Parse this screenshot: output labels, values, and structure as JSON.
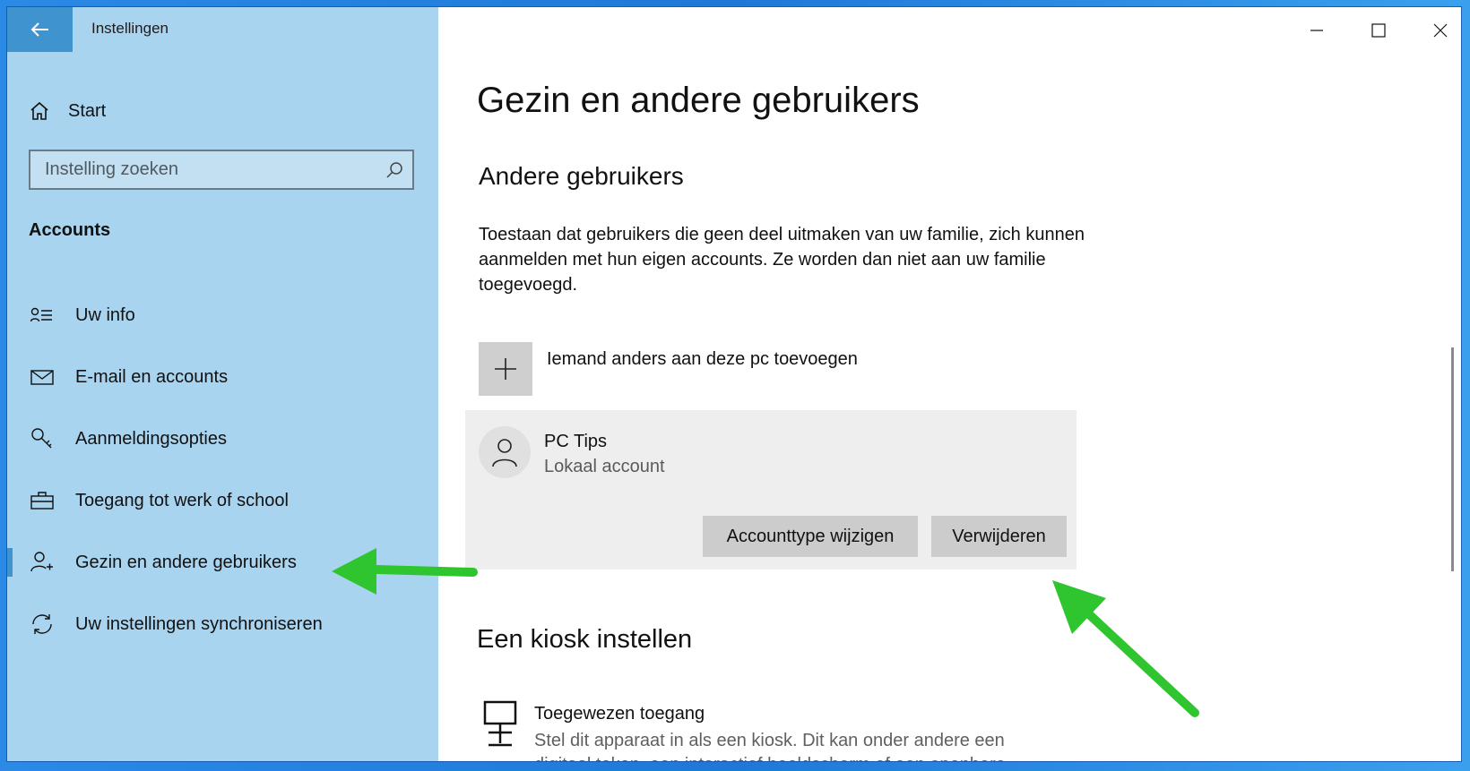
{
  "window": {
    "title": "Instellingen"
  },
  "sidebar": {
    "home_label": "Start",
    "search_placeholder": "Instelling zoeken",
    "section_label": "Accounts",
    "items": [
      {
        "label": "Uw info",
        "icon": "user-info-icon"
      },
      {
        "label": "E-mail en accounts",
        "icon": "mail-icon"
      },
      {
        "label": "Aanmeldingsopties",
        "icon": "key-icon"
      },
      {
        "label": "Toegang tot werk of school",
        "icon": "briefcase-icon"
      },
      {
        "label": "Gezin en andere gebruikers",
        "icon": "person-add-icon",
        "active": true
      },
      {
        "label": "Uw instellingen synchroniseren",
        "icon": "sync-icon"
      }
    ]
  },
  "main": {
    "title": "Gezin en andere gebruikers",
    "section_title": "Andere gebruikers",
    "description": "Toestaan dat gebruikers die geen deel uitmaken van uw familie, zich kunnen aanmelden met hun eigen accounts. Ze worden dan niet aan uw familie toegevoegd.",
    "add_label": "Iemand anders aan deze pc toevoegen",
    "user": {
      "name": "PC Tips",
      "type": "Lokaal account",
      "change_type_label": "Accounttype wijzigen",
      "remove_label": "Verwijderen"
    },
    "kiosk": {
      "title": "Een kiosk instellen",
      "item_title": "Toegewezen toegang",
      "item_desc": "Stel dit apparaat in als een kiosk. Dit kan onder andere een digitaal teken, een interactief beeldscherm of een openbare"
    }
  },
  "colors": {
    "sidebar_bg": "#a9d4ef",
    "accent": "#3f93cf",
    "annotation_arrow": "#2ec52e"
  }
}
